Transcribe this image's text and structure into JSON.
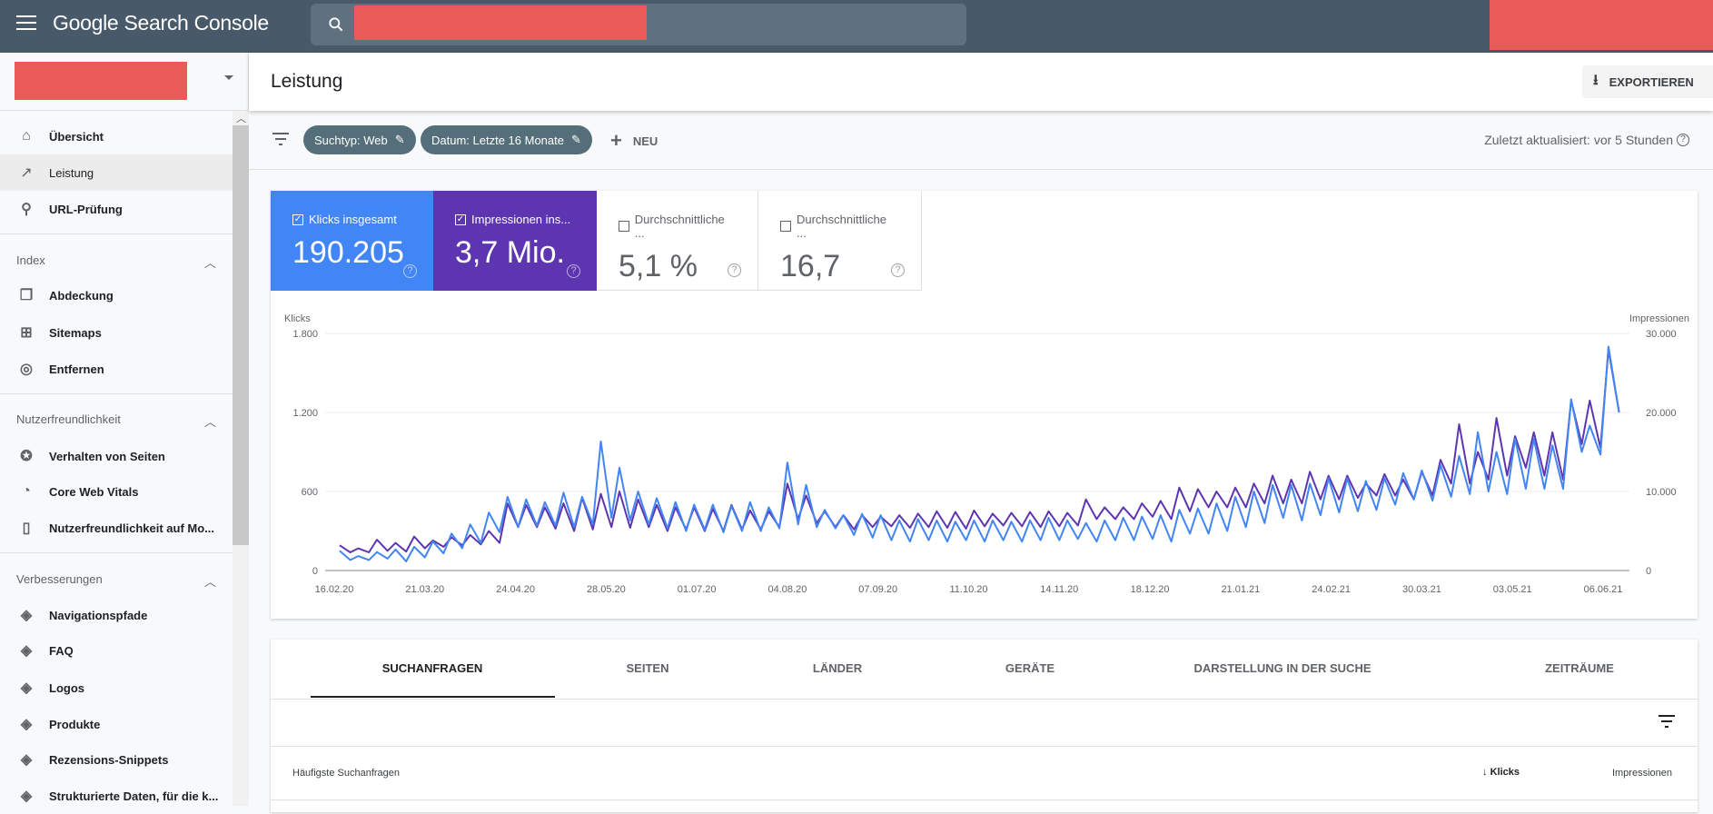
{
  "app": {
    "title": "Google Search Console"
  },
  "header": {
    "title": "Leistung",
    "export_label": "EXPORTIEREN"
  },
  "filters": {
    "chips": [
      "Suchtyp: Web",
      "Datum: Letzte 16 Monate"
    ],
    "new_label": "NEU",
    "updated": "Zuletzt aktualisiert: vor 5 Stunden"
  },
  "sidebar": {
    "items": [
      {
        "label": "Übersicht",
        "icon": "home-icon"
      },
      {
        "label": "Leistung",
        "icon": "trending-up-icon",
        "selected": true
      },
      {
        "label": "URL-Prüfung",
        "icon": "search-icon"
      }
    ],
    "sections": [
      {
        "title": "Index",
        "items": [
          {
            "label": "Abdeckung",
            "icon": "copy-icon"
          },
          {
            "label": "Sitemaps",
            "icon": "sitemap-icon"
          },
          {
            "label": "Entfernen",
            "icon": "eye-off-icon"
          }
        ]
      },
      {
        "title": "Nutzerfreundlichkeit",
        "items": [
          {
            "label": "Verhalten von Seiten",
            "icon": "badge-icon"
          },
          {
            "label": "Core Web Vitals",
            "icon": "speedometer-icon"
          },
          {
            "label": "Nutzerfreundlichkeit auf Mo...",
            "icon": "phone-icon"
          }
        ]
      },
      {
        "title": "Verbesserungen",
        "items": [
          {
            "label": "Navigationspfade",
            "icon": "layers-icon"
          },
          {
            "label": "FAQ",
            "icon": "layers-icon"
          },
          {
            "label": "Logos",
            "icon": "layers-icon"
          },
          {
            "label": "Produkte",
            "icon": "layers-icon"
          },
          {
            "label": "Rezensions-Snippets",
            "icon": "layers-icon"
          },
          {
            "label": "Strukturierte Daten, für die k...",
            "icon": "layers-icon"
          }
        ]
      }
    ]
  },
  "metrics": [
    {
      "label": "Klicks insgesamt",
      "value": "190.205",
      "checked": true,
      "color": "#4285f4"
    },
    {
      "label": "Impressionen ins...",
      "value": "3,7 Mio.",
      "checked": true,
      "color": "#5e35b1"
    },
    {
      "label": "Durchschnittliche ...",
      "value": "5,1 %",
      "checked": false
    },
    {
      "label": "Durchschnittliche ...",
      "value": "16,7",
      "checked": false
    }
  ],
  "chart_data": {
    "type": "line",
    "ylabel_left": "Klicks",
    "ylabel_right": "Impressionen",
    "ylim_left": [
      0,
      1800
    ],
    "ylim_right": [
      0,
      30000
    ],
    "yticks_left": [
      "0",
      "600",
      "1.200",
      "1.800"
    ],
    "yticks_right": [
      "0",
      "10.000",
      "20.000",
      "30.000"
    ],
    "xticks": [
      "16.02.20",
      "21.03.20",
      "24.04.20",
      "28.05.20",
      "01.07.20",
      "04.08.20",
      "07.09.20",
      "11.10.20",
      "14.11.20",
      "18.12.20",
      "21.01.21",
      "24.02.21",
      "30.03.21",
      "03.05.21",
      "06.06.21"
    ],
    "grid": true,
    "x": [
      "18.02.20",
      "22.02.20",
      "25.02.20",
      "29.02.20",
      "03.03.20",
      "07.03.20",
      "10.03.20",
      "14.03.20",
      "17.03.20",
      "21.03.20",
      "24.03.20",
      "28.03.20",
      "31.03.20",
      "04.04.20",
      "07.04.20",
      "11.04.20",
      "14.04.20",
      "18.04.20",
      "21.04.20",
      "25.04.20",
      "28.04.20",
      "02.05.20",
      "05.05.20",
      "09.05.20",
      "12.05.20",
      "16.05.20",
      "19.05.20",
      "23.05.20",
      "26.05.20",
      "30.05.20",
      "02.06.20",
      "06.06.20",
      "09.06.20",
      "13.06.20",
      "16.06.20",
      "20.06.20",
      "23.06.20",
      "27.06.20",
      "30.06.20",
      "04.07.20",
      "07.07.20",
      "11.07.20",
      "14.07.20",
      "18.07.20",
      "21.07.20",
      "25.07.20",
      "28.07.20",
      "01.08.20",
      "04.08.20",
      "08.08.20",
      "11.08.20",
      "15.08.20",
      "18.08.20",
      "22.08.20",
      "25.08.20",
      "29.08.20",
      "01.09.20",
      "05.09.20",
      "08.09.20",
      "12.09.20",
      "15.09.20",
      "19.09.20",
      "22.09.20",
      "26.09.20",
      "29.09.20",
      "03.10.20",
      "06.10.20",
      "10.10.20",
      "13.10.20",
      "17.10.20",
      "20.10.20",
      "24.10.20",
      "27.10.20",
      "31.10.20",
      "03.11.20",
      "07.11.20",
      "10.11.20",
      "14.11.20",
      "17.11.20",
      "21.11.20",
      "24.11.20",
      "28.11.20",
      "01.12.20",
      "05.12.20",
      "08.12.20",
      "12.12.20",
      "15.12.20",
      "19.12.20",
      "22.12.20",
      "26.12.20",
      "29.12.20",
      "02.01.21",
      "05.01.21",
      "09.01.21",
      "12.01.21",
      "16.01.21",
      "19.01.21",
      "23.01.21",
      "26.01.21",
      "30.01.21",
      "02.02.21",
      "06.02.21",
      "09.02.21",
      "13.02.21",
      "16.02.21",
      "20.02.21",
      "23.02.21",
      "27.02.21",
      "02.03.21",
      "06.03.21",
      "09.03.21",
      "13.03.21",
      "16.03.21",
      "20.03.21",
      "23.03.21",
      "27.03.21",
      "30.03.21",
      "03.04.21",
      "06.04.21",
      "10.04.21",
      "13.04.21",
      "17.04.21",
      "20.04.21",
      "24.04.21",
      "27.04.21",
      "01.05.21",
      "04.05.21",
      "08.05.21",
      "11.05.21",
      "15.05.21",
      "18.05.21",
      "22.05.21",
      "25.05.21",
      "29.05.21",
      "01.06.21",
      "05.06.21",
      "08.06.21",
      "12.06.21"
    ],
    "series": [
      {
        "name": "Klicks",
        "axis": "left",
        "color": "#4285f4",
        "values": [
          150,
          80,
          110,
          80,
          140,
          90,
          160,
          70,
          180,
          100,
          220,
          130,
          280,
          170,
          350,
          210,
          440,
          290,
          560,
          330,
          540,
          340,
          520,
          340,
          590,
          330,
          560,
          350,
          980,
          400,
          780,
          380,
          600,
          350,
          550,
          320,
          520,
          300,
          500,
          310,
          500,
          290,
          490,
          300,
          520,
          300,
          480,
          320,
          820,
          350,
          650,
          330,
          460,
          320,
          420,
          270,
          430,
          250,
          420,
          230,
          380,
          220,
          390,
          230,
          380,
          220,
          370,
          230,
          380,
          220,
          380,
          230,
          370,
          220,
          380,
          230,
          400,
          230,
          380,
          240,
          360,
          220,
          380,
          230,
          400,
          230,
          410,
          240,
          420,
          220,
          460,
          280,
          470,
          280,
          510,
          300,
          560,
          330,
          600,
          360,
          650,
          400,
          650,
          380,
          660,
          420,
          700,
          440,
          700,
          450,
          680,
          460,
          700,
          500,
          740,
          540,
          760,
          530,
          800,
          560,
          870,
          580,
          1050,
          600,
          900,
          580,
          1000,
          620,
          1000,
          620,
          950,
          620,
          1300,
          900,
          1100,
          880,
          1700,
          1200
        ]
      },
      {
        "name": "Impressionen",
        "axis": "right",
        "color": "#5e35b1",
        "values": [
          3200,
          2300,
          2800,
          2300,
          3900,
          2500,
          3500,
          2400,
          4300,
          2800,
          3800,
          3000,
          4200,
          3200,
          4500,
          3300,
          5000,
          3500,
          8500,
          5500,
          8300,
          5500,
          8000,
          5300,
          8500,
          5000,
          9200,
          5200,
          9700,
          5500,
          10000,
          5400,
          9000,
          5500,
          8300,
          5000,
          8000,
          5200,
          8000,
          5000,
          7800,
          5000,
          8300,
          5200,
          7600,
          5200,
          7500,
          5500,
          11000,
          6500,
          9500,
          6000,
          7500,
          5500,
          7000,
          5200,
          7000,
          5500,
          6800,
          5600,
          7000,
          5400,
          7200,
          5500,
          7500,
          5400,
          7400,
          5300,
          7600,
          5600,
          7200,
          5700,
          7300,
          5600,
          7400,
          5500,
          7500,
          5600,
          7300,
          5700,
          9000,
          6500,
          8000,
          6500,
          8000,
          6500,
          8500,
          6800,
          8800,
          6500,
          10500,
          7500,
          10300,
          8000,
          10000,
          8000,
          10500,
          8000,
          11000,
          8500,
          12000,
          8500,
          11500,
          8500,
          12500,
          9000,
          12000,
          9000,
          12000,
          9200,
          11000,
          9500,
          12200,
          9500,
          11500,
          9000,
          12500,
          9500,
          14000,
          11000,
          18500,
          11000,
          15000,
          11500,
          19300,
          12000,
          17000,
          13000,
          17500,
          12000,
          17500,
          11500,
          21500,
          16000,
          21500,
          15500,
          28000,
          20000
        ]
      }
    ]
  },
  "table": {
    "tabs": [
      "SUCHANFRAGEN",
      "SEITEN",
      "LÄNDER",
      "GERÄTE",
      "DARSTELLUNG IN DER SUCHE",
      "ZEITRÄUME"
    ],
    "active_tab": 0,
    "columns": [
      "Häufigste Suchanfragen",
      "Klicks",
      "Impressionen"
    ],
    "sort_column": "Klicks"
  }
}
